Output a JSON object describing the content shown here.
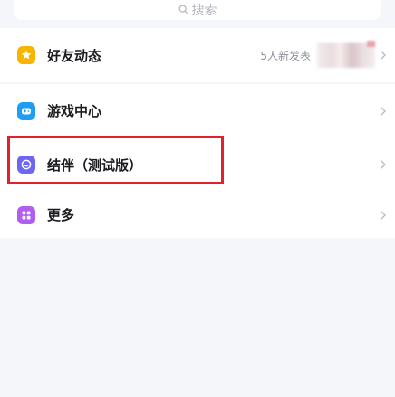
{
  "search": {
    "placeholder": "搜索",
    "icon": "search-icon"
  },
  "groups": [
    {
      "items": [
        {
          "label": "好友动态",
          "icon": "star-icon",
          "color": "#f7b500",
          "extra": "5人新发表"
        }
      ]
    },
    {
      "items": [
        {
          "label": "游戏中心",
          "icon": "gamepad-icon",
          "color": "#1e9df2"
        },
        {
          "label": "结伴（测试版）",
          "icon": "companion-icon",
          "color": "#6c66f0"
        },
        {
          "label": "更多",
          "icon": "grid-icon",
          "color": "#b15df1"
        }
      ]
    }
  ],
  "highlight": {
    "color": "#e3202e"
  }
}
